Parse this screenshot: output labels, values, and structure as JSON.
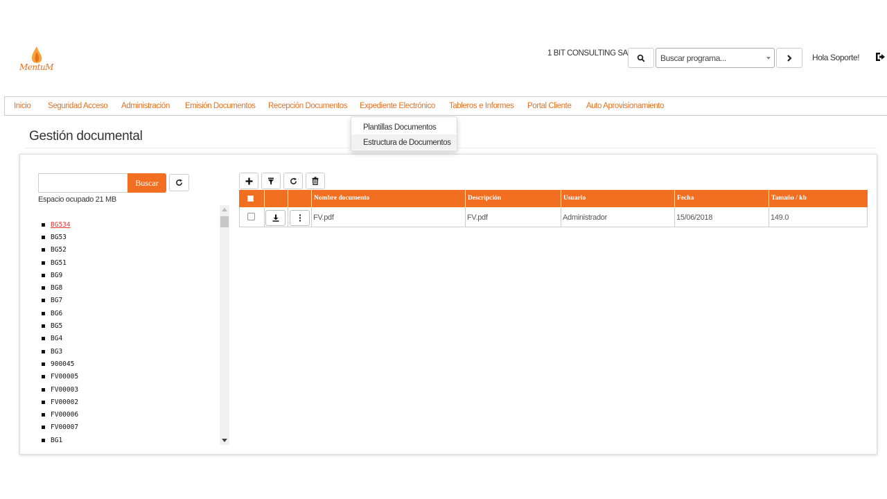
{
  "header": {
    "logo_text": "MentuM",
    "company": "1 BIT CONSULTING SAS",
    "program_search": {
      "value": "Buscar programa..."
    },
    "greeting": "Hola Soporte!"
  },
  "nav": {
    "items": [
      {
        "label": "Inicio"
      },
      {
        "label": "Seguridad Acceso"
      },
      {
        "label": "Administración"
      },
      {
        "label": "Emisión Documentos"
      },
      {
        "label": "Recepción Documentos"
      },
      {
        "label": "Expediente Electrónico"
      },
      {
        "label": "Tableros e Informes"
      },
      {
        "label": "Portal Cliente"
      },
      {
        "label": "Auto Aprovisionamiento"
      }
    ],
    "dropdown": [
      {
        "label": "Plantillas Documentos"
      },
      {
        "label": "Estructura de Documentos"
      }
    ]
  },
  "page": {
    "title": "Gestión documental"
  },
  "tree": {
    "search_value": "",
    "search_button": "Buscar",
    "space_used": "Espacio ocupado 21 MB",
    "items": [
      "BG534",
      "BG53",
      "BG52",
      "BG51",
      "BG9",
      "BG8",
      "BG7",
      "BG6",
      "BG5",
      "BG4",
      "BG3",
      "900045",
      "FV00005",
      "FV00003",
      "FV00002",
      "FV00006",
      "FV00007",
      "BG1"
    ],
    "selected": "BG534"
  },
  "table": {
    "columns": [
      "Nombre documento",
      "Descripción",
      "Usuario",
      "Fecha",
      "Tamaño / kb"
    ],
    "rows": [
      {
        "nombre": "FV.pdf",
        "descripcion": "FV.pdf",
        "usuario": "Administrador",
        "fecha": "15/06/2018",
        "tamano": "149.0"
      }
    ]
  },
  "colors": {
    "accent": "#f26f21",
    "link": "#e8701f",
    "selected": "#e33333"
  },
  "icons": [
    "logo-flame-icon",
    "search-icon",
    "chevron-right-icon",
    "logout-icon",
    "refresh-icon",
    "plus-icon",
    "filter-icon",
    "trash-icon",
    "download-icon",
    "kebab-menu-icon"
  ]
}
